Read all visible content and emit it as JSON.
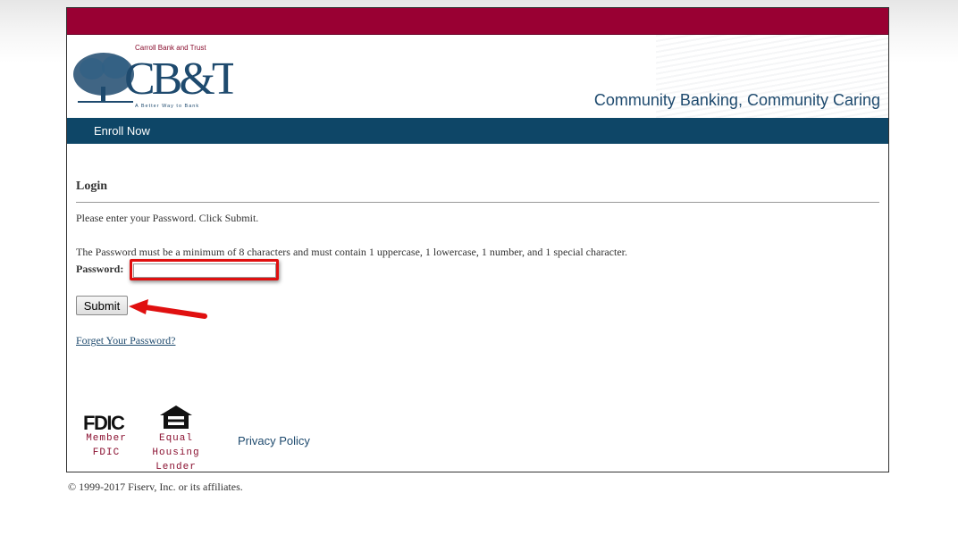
{
  "header": {
    "brand_name": "Carroll Bank and Trust",
    "brand_initials": "CB&T",
    "brand_slogan": "A Better Way to Bank",
    "tagline": "Community Banking, Community Caring"
  },
  "nav": {
    "enroll_label": "Enroll Now"
  },
  "login": {
    "title": "Login",
    "instruction": "Please enter your Password. Click Submit.",
    "requirements": "The Password must be a minimum of 8 characters and must contain 1 uppercase, 1 lowercase, 1 number, and 1 special character.",
    "password_label": "Password:",
    "password_value": "",
    "submit_label": "Submit",
    "forgot_label": "Forget Your Password?"
  },
  "footer": {
    "fdic_logo_text": "FDIC",
    "fdic_caption_line1": "Member",
    "fdic_caption_line2": "FDIC",
    "ehl_caption_line1": "Equal",
    "ehl_caption_line2": "Housing",
    "ehl_caption_line3": "Lender",
    "privacy_label": "Privacy Policy",
    "copyright": "© 1999-2017 Fiserv, Inc. or its affiliates."
  },
  "colors": {
    "top_bar": "#990033",
    "nav_bar": "#0e4667",
    "tagline": "#1e4a6e",
    "highlight": "#e01010"
  },
  "annotations": {
    "highlight_icon": "red-highlight-box",
    "arrow_icon": "red-arrow-icon"
  }
}
